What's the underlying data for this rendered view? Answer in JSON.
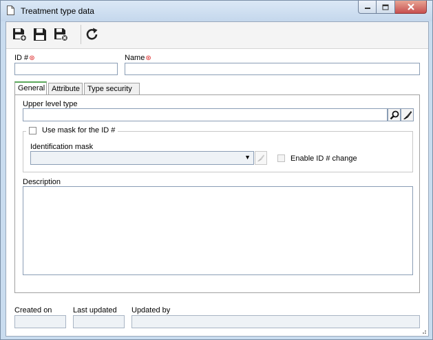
{
  "window": {
    "title": "Treatment type data",
    "icon": "document-icon",
    "controls": [
      "minimize-icon",
      "maximize-icon",
      "close-icon"
    ]
  },
  "toolbar": {
    "buttons": [
      {
        "name": "save-and-new-button",
        "icon": "save-new-icon"
      },
      {
        "name": "save-button",
        "icon": "save-icon"
      },
      {
        "name": "save-and-close-button",
        "icon": "save-close-icon"
      },
      {
        "name": "refresh-button",
        "icon": "refresh-icon"
      }
    ]
  },
  "header": {
    "id_label": "ID #",
    "id_value": "",
    "name_label": "Name",
    "name_value": "",
    "required_marker": "⊛"
  },
  "tabs": [
    {
      "label": "General",
      "active": true
    },
    {
      "label": "Attribute",
      "active": false
    },
    {
      "label": "Type security",
      "active": false
    }
  ],
  "general": {
    "upper_level_label": "Upper level type",
    "upper_level_value": "",
    "use_mask_label": "Use mask for the ID #",
    "use_mask_checked": false,
    "mask_label": "Identification mask",
    "mask_value": "",
    "enable_change_label": "Enable ID # change",
    "enable_change_checked": false,
    "description_label": "Description",
    "description_value": ""
  },
  "footer": {
    "created_label": "Created on",
    "created_value": "",
    "updated_label": "Last updated",
    "updated_value": "",
    "updated_by_label": "Updated by",
    "updated_by_value": ""
  },
  "colors": {
    "frame": "#c9dcef",
    "required": "#dd2222",
    "active_tab": "#5aa85a"
  }
}
